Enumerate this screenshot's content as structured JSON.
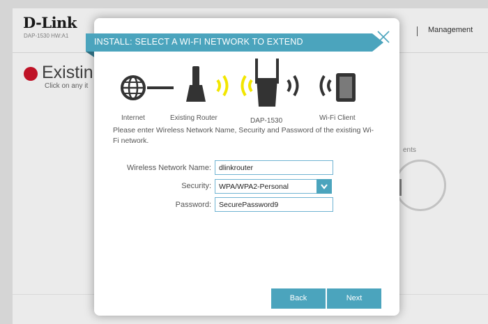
{
  "app": {
    "logo": "D-Link",
    "model": "DAP-1530   HW:A1",
    "nav_management": "Management",
    "page_title": "Existin",
    "page_subtitle": "Click on any it",
    "clients_label": "ents"
  },
  "modal": {
    "title": "INSTALL: SELECT A WI-FI NETWORK TO EXTEND",
    "diagram": {
      "internet_label": "Internet",
      "router_label": "Existing Router",
      "extender_label": "DAP-1530",
      "client_label": "Wi-Fi Client"
    },
    "instructions": "Please enter Wireless Network Name, Security and Password of the existing Wi-Fi network.",
    "form": {
      "ssid_label": "Wireless Network Name:",
      "ssid_value": "dlinkrouter",
      "security_label": "Security:",
      "security_value": "WPA/WPA2-Personal",
      "password_label": "Password:",
      "password_value": "SecurePassword9"
    },
    "buttons": {
      "back": "Back",
      "next": "Next"
    }
  },
  "colors": {
    "accent": "#4ba4bd",
    "wifi_wave": "#f2e600",
    "status_red": "#d0142a"
  },
  "icons": [
    "globe-icon",
    "router-icon",
    "extender-icon",
    "wifi-client-icon",
    "close-icon",
    "chevron-down-icon"
  ]
}
